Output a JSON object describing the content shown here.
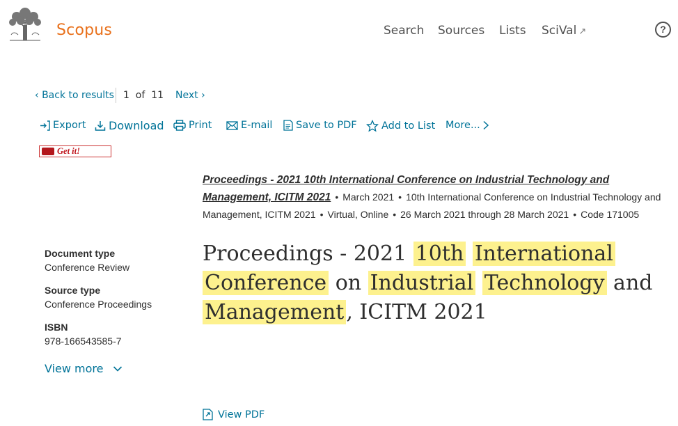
{
  "header": {
    "brand": "Scopus",
    "nav": [
      "Search",
      "Sources",
      "Lists",
      "SciVal"
    ],
    "help": "?"
  },
  "result_nav": {
    "back": "Back to results",
    "counter": "1  of  11",
    "next": "Next"
  },
  "toolbar": {
    "export": "Export",
    "download": "Download",
    "print": "Print",
    "email": "E-mail",
    "save_pdf": "Save to PDF",
    "add_list": "Add to List",
    "more": "More..."
  },
  "getit": "Get it!",
  "source": {
    "title": "Proceedings - 2021 10th International Conference on Industrial Technology and Management, ICITM 2021",
    "date": "March 2021",
    "conference": "10th International Conference on Industrial Technology and Management, ICITM 2021",
    "location": "Virtual, Online",
    "dates": "26 March 2021 through 28 March 2021",
    "code": "Code 171005"
  },
  "document": {
    "title_parts": [
      "Proceedings - 2021 ",
      "10th",
      " ",
      "International",
      " ",
      "Conference",
      " on ",
      "Industrial",
      " ",
      "Technology",
      " and ",
      "Management",
      ", ICITM 2021"
    ]
  },
  "side": {
    "doc_type_label": "Document type",
    "doc_type": "Conference Review",
    "source_type_label": "Source type",
    "source_type": "Conference Proceedings",
    "isbn_label": "ISBN",
    "isbn": "978-166543585-7",
    "view_more": "View more"
  },
  "view_pdf": "View PDF",
  "colors": {
    "brand": "#e9711c",
    "link": "#007398",
    "highlight": "#fdf18e"
  }
}
